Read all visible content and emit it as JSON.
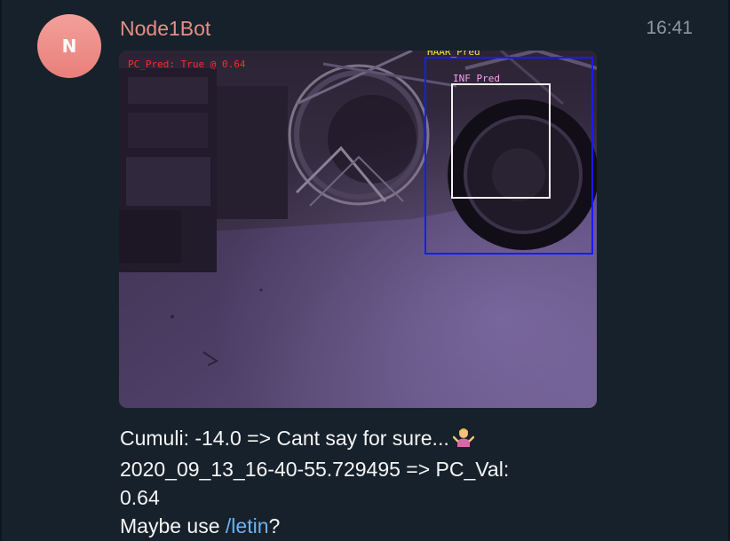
{
  "message": {
    "avatar_initial": "N",
    "sender": "Node1Bot",
    "time": "16:41",
    "caption": {
      "line1": "Cumuli: -14.0 => Cant say for sure...",
      "line1_emoji": "person-shrugging-emoji",
      "line2": "2020_09_13_16-40-55.729495 => PC_Val:",
      "line3": "0.64",
      "line4_prefix": "Maybe use ",
      "line4_link": "/letin",
      "line4_suffix": "?"
    }
  },
  "photo": {
    "overlay_labels": {
      "pc_pred": "PC_Pred: True @ 0.64",
      "haar_pred": "HAAR_Pred",
      "inf_pred": "INF_Pred"
    },
    "colors": {
      "pc_pred": "#ff2a2a",
      "haar_box": "#1a1aff",
      "haar_label": "#f0e34a",
      "inf_box": "#f2f2f2",
      "inf_label": "#ff9ef0"
    }
  },
  "colors": {
    "background": "#17212b",
    "sender": "#e58e83",
    "link": "#6ab3f3",
    "avatar": "#ea837d"
  }
}
